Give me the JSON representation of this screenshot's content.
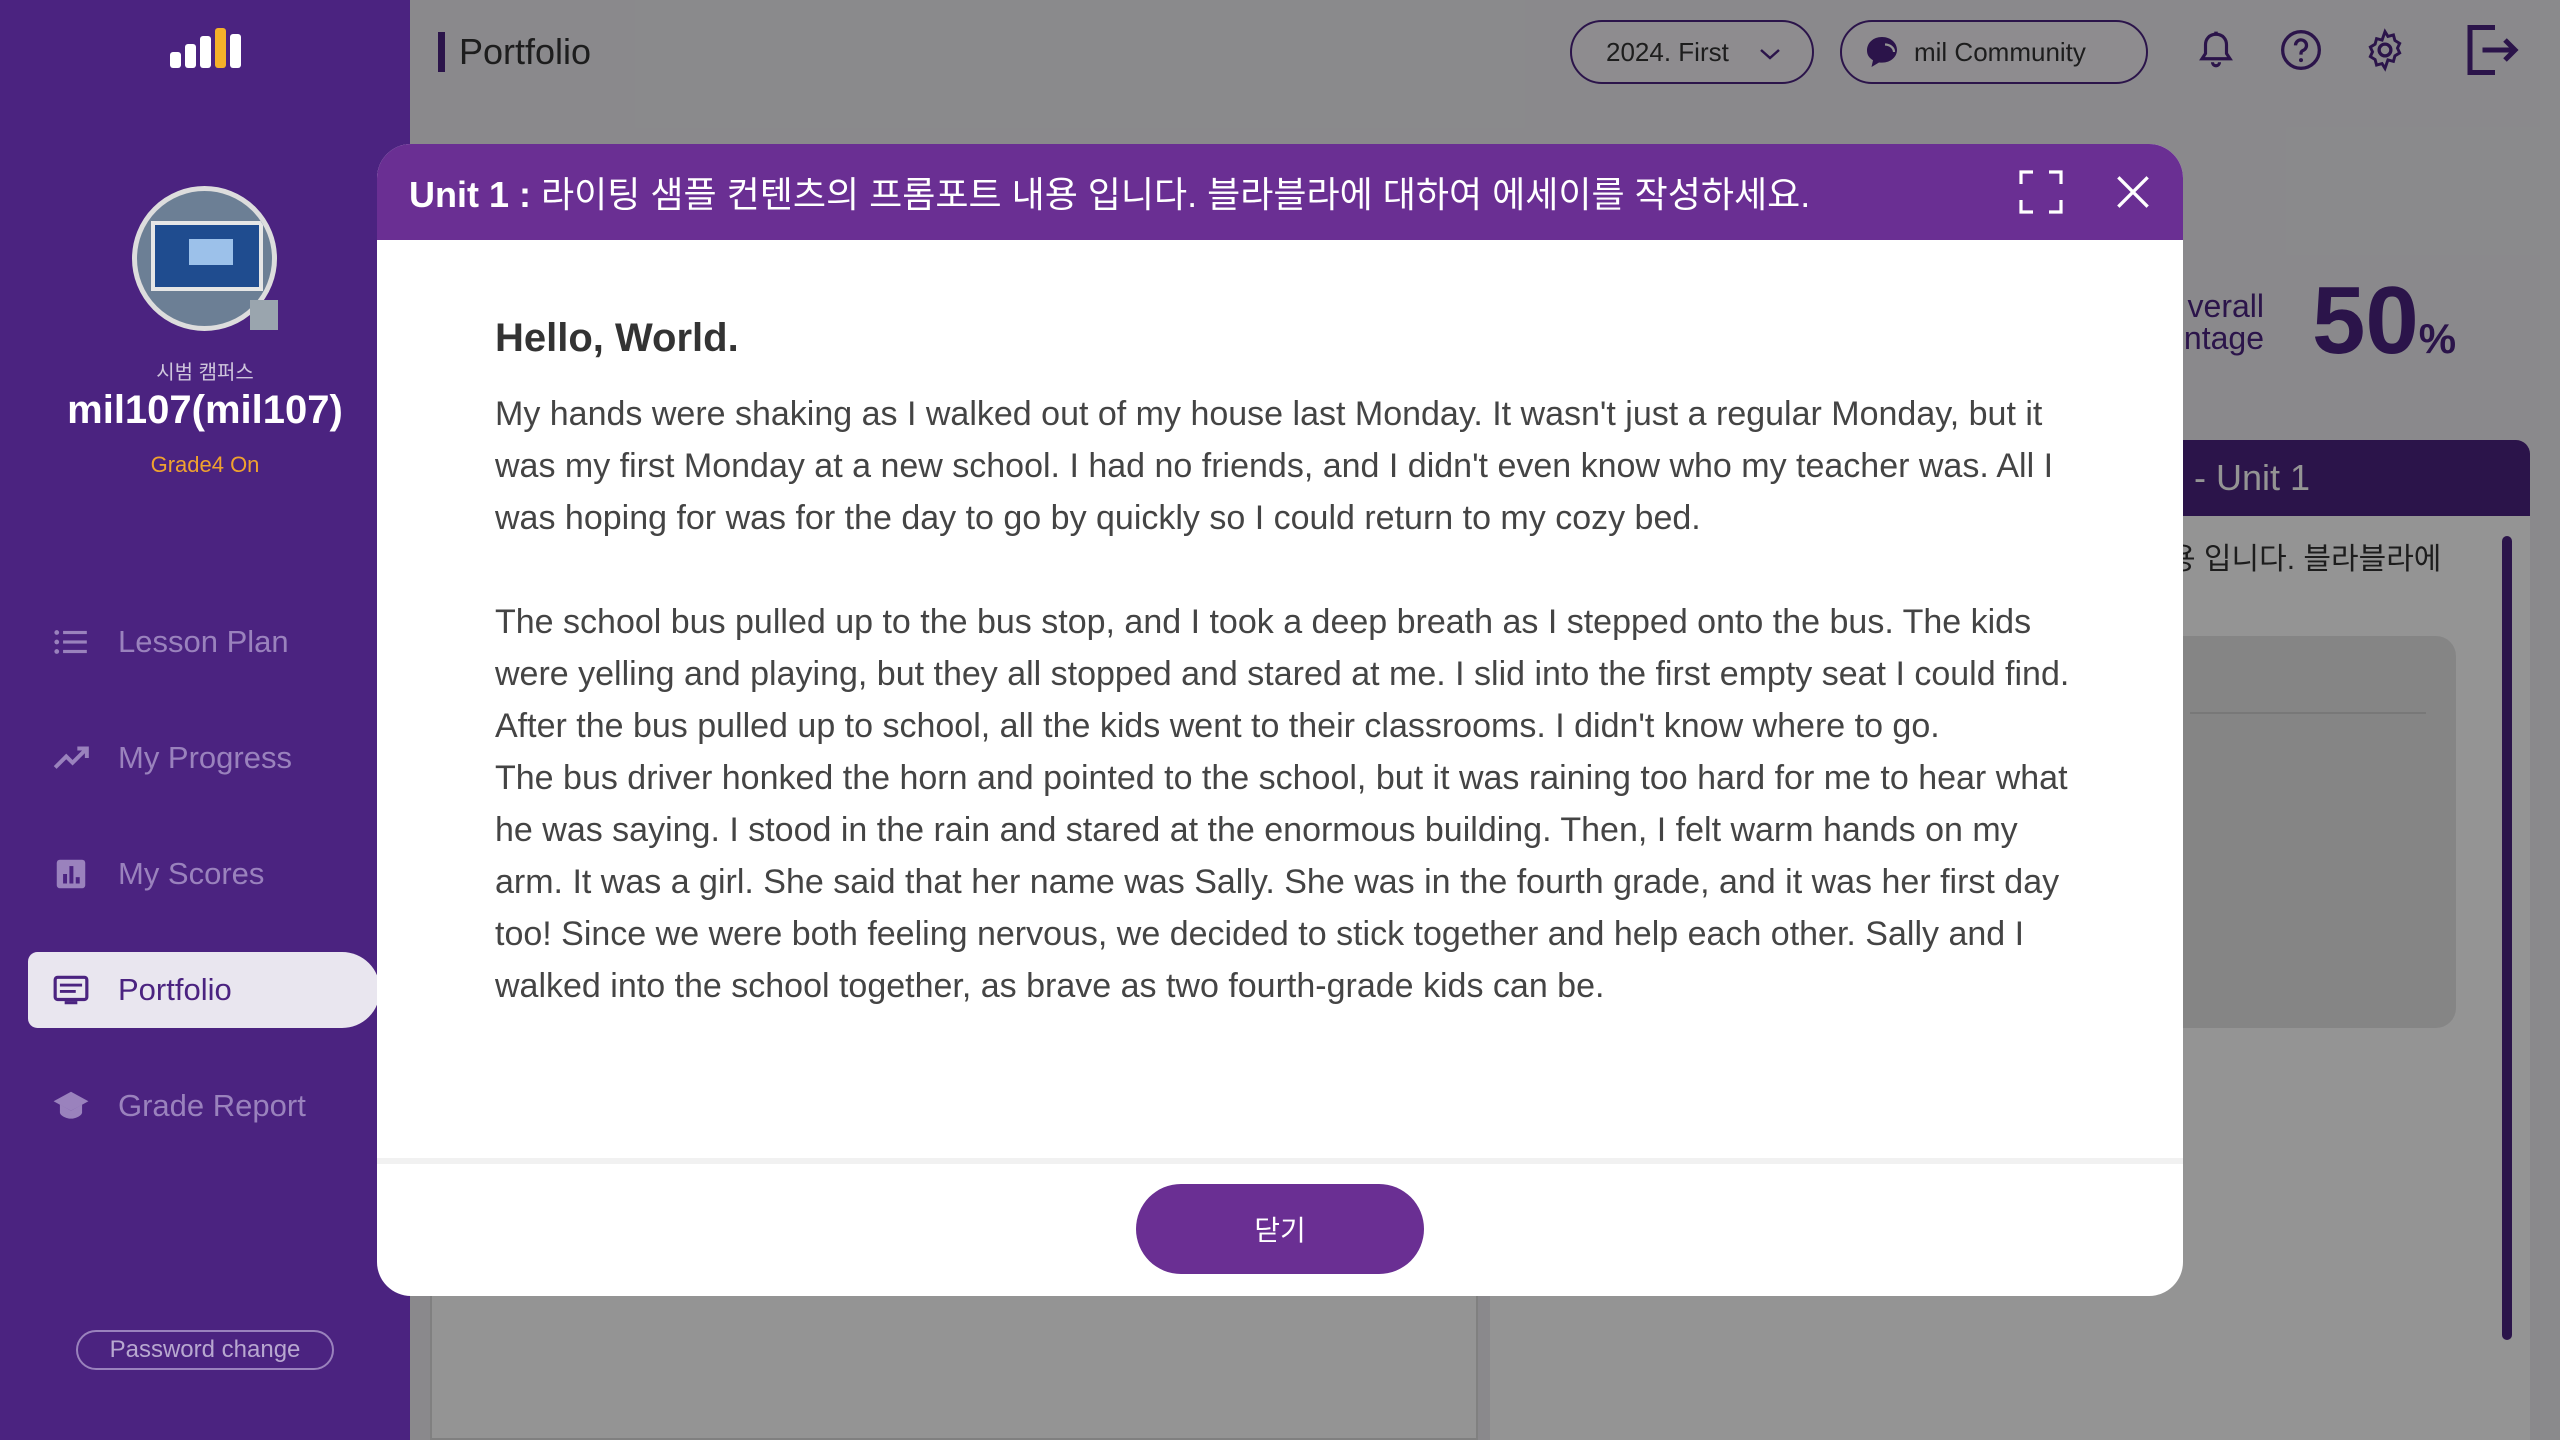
{
  "sidebar": {
    "campus": "시범 캠퍼스",
    "username": "mil107(mil107)",
    "grade": "Grade4 On",
    "nav": [
      {
        "label": "Lesson Plan",
        "icon": "list-icon"
      },
      {
        "label": "My Progress",
        "icon": "trend-icon"
      },
      {
        "label": "My Scores",
        "icon": "bar-chart-icon"
      },
      {
        "label": "Portfolio",
        "icon": "portfolio-icon",
        "active": true
      },
      {
        "label": "Grade Report",
        "icon": "graduation-cap-icon"
      }
    ],
    "password_change": "Password change"
  },
  "header": {
    "title": "Portfolio",
    "term": "2024. First",
    "community": "mil Community"
  },
  "background": {
    "overall_label_line1": "verall",
    "overall_label_line2": "ntage",
    "overall_value": "50",
    "overall_unit": "%",
    "unit_banner": "- Unit 1",
    "prompt_fragment": "용 입니다. 블라블라에"
  },
  "modal": {
    "title_prefix": "Unit 1 :",
    "title_text": " 라이팅 샘플 컨텐츠의 프롬포트 내용 입니다. 블라블라에 대하여 에세이를 작성하세요.",
    "essay_title": "Hello, World.",
    "paragraphs": [
      "My hands were shaking as I walked out of my house last Monday. It wasn't just a regular Monday, but it was my first Monday at a new school. I had no friends, and I didn't even know who my teacher was. All I was hoping for was for the day to go by quickly so I could return to my cozy bed.",
      "The school bus pulled up to the bus stop, and I took a deep breath as I stepped onto the bus. The kids were yelling and playing, but they all stopped and stared at me. I slid into the first empty seat I could find. After the bus pulled up to school, all the kids went to their classrooms. I didn't know where to go.",
      "The bus driver honked the horn and pointed to the school, but it was raining too hard for me to hear what he was saying. I stood in the rain and stared at the enormous building. Then, I felt warm hands on my arm. It was a girl. She said that her name was Sally. She was in the fourth grade, and it was her first day too! Since we were both feeling nervous, we decided to stick together and help each other. Sally and I walked into the school together, as brave as two fourth-grade kids can be."
    ],
    "close_label": "닫기"
  },
  "colors": {
    "brand": "#4b2380",
    "modal_header": "#6a2f93",
    "accent": "#f0a22e"
  }
}
